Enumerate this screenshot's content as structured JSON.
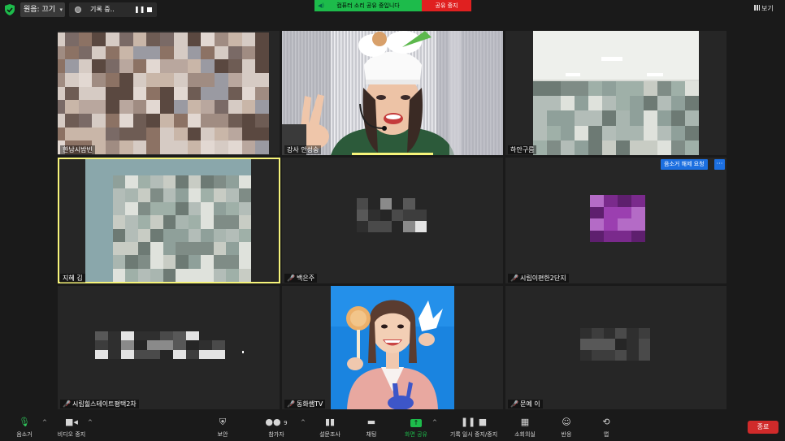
{
  "topbar": {
    "original_label": "원음: 끄기",
    "recording_label": "기록 중..",
    "share_banner": "컴퓨터 소리 공유 중입니다",
    "stop_share": "공유 중지",
    "view_label": "보기"
  },
  "tiles": {
    "t1": "한남시밤빈",
    "t2": "강사 안성숭",
    "t3": "하안구름",
    "t4": "지혜 김",
    "t5": "백은주",
    "t6": "시립이편한2단지",
    "t7": "시립힐스테이트평택2차",
    "t8": "동화쌤TV",
    "t9": "문예 이"
  },
  "unmute_request": "음소거 해제 요청",
  "more_label": "···",
  "toolbar": {
    "mute": "음소거",
    "video": "비디오 중지",
    "security": "보안",
    "participants": "참가자",
    "participants_count": "9",
    "polls": "설문조사",
    "chat": "채팅",
    "share": "화면 공유",
    "record": "기록 일시 중지/중지",
    "breakout": "소회의실",
    "reactions": "반응",
    "apps": "앱",
    "end": "종료"
  },
  "colors": {
    "share_green": "#1dbb4b",
    "stop_red": "#e02020",
    "active_speaker": "#f6f47a",
    "unmute_blue": "#1c6fe0",
    "end_red": "#d02a2a"
  }
}
